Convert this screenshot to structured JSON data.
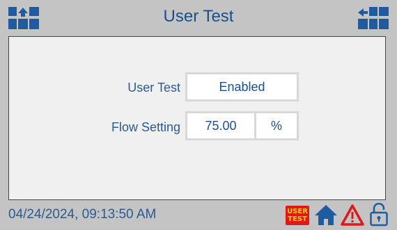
{
  "header": {
    "title": "User Test"
  },
  "form": {
    "user_test_label": "User Test",
    "user_test_value": "Enabled",
    "flow_setting_label": "Flow Setting",
    "flow_setting_value": "75.00",
    "flow_setting_unit": "%"
  },
  "status": {
    "datetime": "04/24/2024, 09:13:50 AM",
    "mode_badge_line1": "USER",
    "mode_badge_line2": "TEST"
  },
  "colors": {
    "title_text": "#1a4f8f",
    "icon_blue": "#1f5b9e",
    "alarm_red": "#e01818",
    "badge_yellow": "#f2d21a"
  },
  "icons": {
    "nav_left": "grid-back-arrow-icon",
    "nav_right": "grid-forward-arrow-icon",
    "home": "home-icon",
    "alarm": "warning-triangle-icon",
    "lock": "unlocked-padlock-icon"
  }
}
